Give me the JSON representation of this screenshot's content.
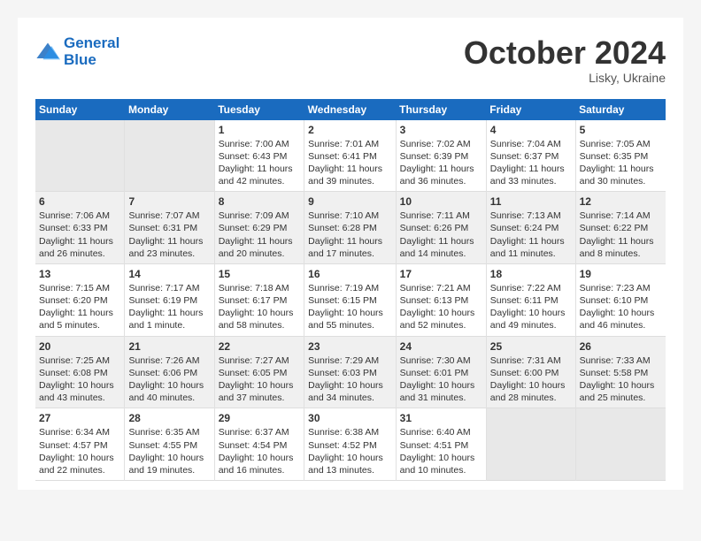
{
  "header": {
    "logo_line1": "General",
    "logo_line2": "Blue",
    "month": "October 2024",
    "location": "Lisky, Ukraine"
  },
  "weekdays": [
    "Sunday",
    "Monday",
    "Tuesday",
    "Wednesday",
    "Thursday",
    "Friday",
    "Saturday"
  ],
  "weeks": [
    [
      {
        "day": "",
        "content": ""
      },
      {
        "day": "",
        "content": ""
      },
      {
        "day": "1",
        "content": "Sunrise: 7:00 AM\nSunset: 6:43 PM\nDaylight: 11 hours and 42 minutes."
      },
      {
        "day": "2",
        "content": "Sunrise: 7:01 AM\nSunset: 6:41 PM\nDaylight: 11 hours and 39 minutes."
      },
      {
        "day": "3",
        "content": "Sunrise: 7:02 AM\nSunset: 6:39 PM\nDaylight: 11 hours and 36 minutes."
      },
      {
        "day": "4",
        "content": "Sunrise: 7:04 AM\nSunset: 6:37 PM\nDaylight: 11 hours and 33 minutes."
      },
      {
        "day": "5",
        "content": "Sunrise: 7:05 AM\nSunset: 6:35 PM\nDaylight: 11 hours and 30 minutes."
      }
    ],
    [
      {
        "day": "6",
        "content": "Sunrise: 7:06 AM\nSunset: 6:33 PM\nDaylight: 11 hours and 26 minutes."
      },
      {
        "day": "7",
        "content": "Sunrise: 7:07 AM\nSunset: 6:31 PM\nDaylight: 11 hours and 23 minutes."
      },
      {
        "day": "8",
        "content": "Sunrise: 7:09 AM\nSunset: 6:29 PM\nDaylight: 11 hours and 20 minutes."
      },
      {
        "day": "9",
        "content": "Sunrise: 7:10 AM\nSunset: 6:28 PM\nDaylight: 11 hours and 17 minutes."
      },
      {
        "day": "10",
        "content": "Sunrise: 7:11 AM\nSunset: 6:26 PM\nDaylight: 11 hours and 14 minutes."
      },
      {
        "day": "11",
        "content": "Sunrise: 7:13 AM\nSunset: 6:24 PM\nDaylight: 11 hours and 11 minutes."
      },
      {
        "day": "12",
        "content": "Sunrise: 7:14 AM\nSunset: 6:22 PM\nDaylight: 11 hours and 8 minutes."
      }
    ],
    [
      {
        "day": "13",
        "content": "Sunrise: 7:15 AM\nSunset: 6:20 PM\nDaylight: 11 hours and 5 minutes."
      },
      {
        "day": "14",
        "content": "Sunrise: 7:17 AM\nSunset: 6:19 PM\nDaylight: 11 hours and 1 minute."
      },
      {
        "day": "15",
        "content": "Sunrise: 7:18 AM\nSunset: 6:17 PM\nDaylight: 10 hours and 58 minutes."
      },
      {
        "day": "16",
        "content": "Sunrise: 7:19 AM\nSunset: 6:15 PM\nDaylight: 10 hours and 55 minutes."
      },
      {
        "day": "17",
        "content": "Sunrise: 7:21 AM\nSunset: 6:13 PM\nDaylight: 10 hours and 52 minutes."
      },
      {
        "day": "18",
        "content": "Sunrise: 7:22 AM\nSunset: 6:11 PM\nDaylight: 10 hours and 49 minutes."
      },
      {
        "day": "19",
        "content": "Sunrise: 7:23 AM\nSunset: 6:10 PM\nDaylight: 10 hours and 46 minutes."
      }
    ],
    [
      {
        "day": "20",
        "content": "Sunrise: 7:25 AM\nSunset: 6:08 PM\nDaylight: 10 hours and 43 minutes."
      },
      {
        "day": "21",
        "content": "Sunrise: 7:26 AM\nSunset: 6:06 PM\nDaylight: 10 hours and 40 minutes."
      },
      {
        "day": "22",
        "content": "Sunrise: 7:27 AM\nSunset: 6:05 PM\nDaylight: 10 hours and 37 minutes."
      },
      {
        "day": "23",
        "content": "Sunrise: 7:29 AM\nSunset: 6:03 PM\nDaylight: 10 hours and 34 minutes."
      },
      {
        "day": "24",
        "content": "Sunrise: 7:30 AM\nSunset: 6:01 PM\nDaylight: 10 hours and 31 minutes."
      },
      {
        "day": "25",
        "content": "Sunrise: 7:31 AM\nSunset: 6:00 PM\nDaylight: 10 hours and 28 minutes."
      },
      {
        "day": "26",
        "content": "Sunrise: 7:33 AM\nSunset: 5:58 PM\nDaylight: 10 hours and 25 minutes."
      }
    ],
    [
      {
        "day": "27",
        "content": "Sunrise: 6:34 AM\nSunset: 4:57 PM\nDaylight: 10 hours and 22 minutes."
      },
      {
        "day": "28",
        "content": "Sunrise: 6:35 AM\nSunset: 4:55 PM\nDaylight: 10 hours and 19 minutes."
      },
      {
        "day": "29",
        "content": "Sunrise: 6:37 AM\nSunset: 4:54 PM\nDaylight: 10 hours and 16 minutes."
      },
      {
        "day": "30",
        "content": "Sunrise: 6:38 AM\nSunset: 4:52 PM\nDaylight: 10 hours and 13 minutes."
      },
      {
        "day": "31",
        "content": "Sunrise: 6:40 AM\nSunset: 4:51 PM\nDaylight: 10 hours and 10 minutes."
      },
      {
        "day": "",
        "content": ""
      },
      {
        "day": "",
        "content": ""
      }
    ]
  ]
}
